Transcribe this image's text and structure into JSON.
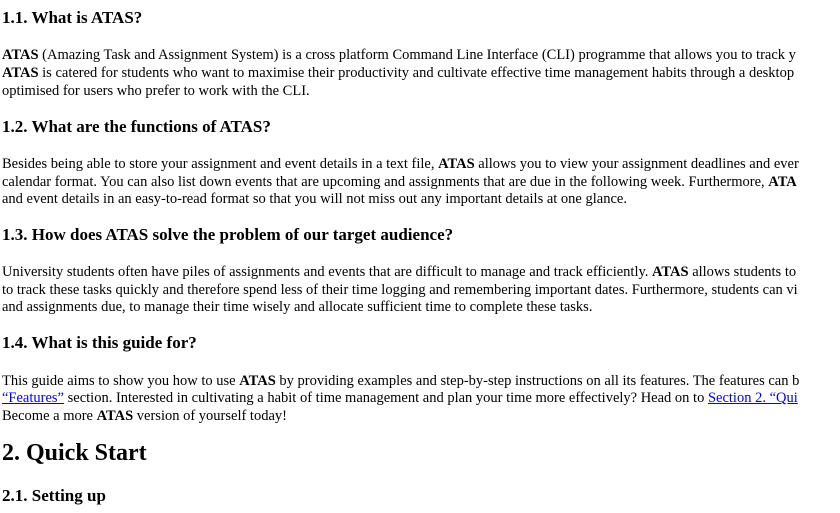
{
  "sections": {
    "s1_1": {
      "title": "1.1. What is ATAS?",
      "l1_b": "ATAS",
      "l1_t": " (Amazing Task and Assignment System) is a cross platform Command Line Interface (CLI) programme that allows you to track y",
      "l2_b": "ATAS",
      "l2_t": " is catered for students who want to maximise their productivity and cultivate effective time management habits through a desktop",
      "l3_t": "optimised for users who prefer to work with the CLI."
    },
    "s1_2": {
      "title": "1.2. What are the functions of ATAS?",
      "l1_t": "Besides being able to store your assignment and event details in a text file, ",
      "l1_b": "ATAS",
      "l1_t2": " allows you to view your assignment deadlines and ever",
      "l2_t": "calendar format. You can also list down events that are upcoming and assignments that are due in the following week. Furthermore, ",
      "l2_b": "ATA",
      "l3_t": "and event details in an easy-to-read format so that you will not miss out any important details at one glance."
    },
    "s1_3": {
      "title": "1.3. How does ATAS solve the problem of our target audience?",
      "l1_t": "University students often have piles of assignments and events that are difficult to manage and track efficiently. ",
      "l1_b": "ATAS",
      "l1_t2": " allows students to",
      "l2_t": "to track these tasks quickly and therefore spend less of their time logging and remembering important dates. Furthermore, students can vi",
      "l3_t": "and assignments due, to manage their time wisely and allocate sufficient time to complete these tasks."
    },
    "s1_4": {
      "title": "1.4. What is this guide for?",
      "l1_t": "This guide aims to show you how to use ",
      "l1_b": "ATAS",
      "l1_t2": " by providing examples and step-by-step instructions on all its features. The features can b",
      "l2_link1": "“Features”",
      "l2_t": " section. Interested in cultivating a habit of time management and plan your time more effectively? Head on to ",
      "l2_link2": "Section 2. “Qui",
      "l3_t": "Become a more ",
      "l3_b": "ATAS",
      "l3_t2": " version of yourself today!"
    },
    "s2": {
      "title": "2. Quick Start"
    },
    "s2_1": {
      "title": "2.1. Setting up"
    }
  }
}
